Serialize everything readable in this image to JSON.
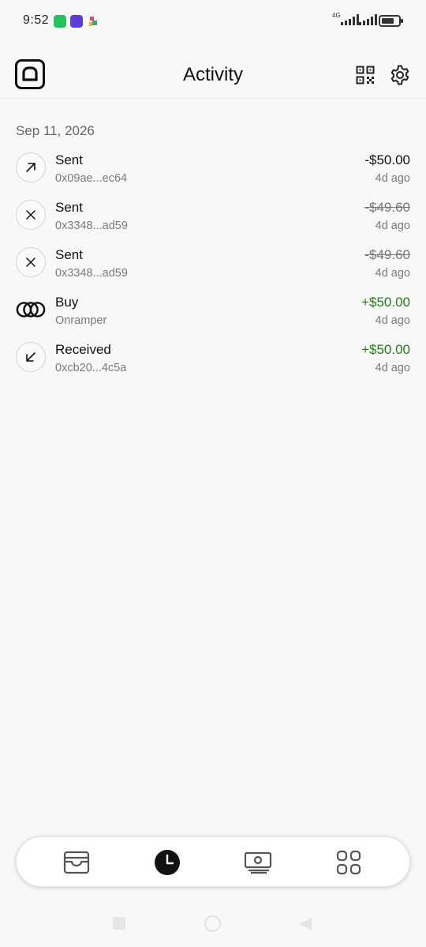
{
  "status_bar": {
    "time": "9:52",
    "network": "4G"
  },
  "header": {
    "title": "Activity",
    "logo_icon": "app-logo-a-icon",
    "qr_icon": "qr-code-icon",
    "settings_icon": "gear-icon"
  },
  "activity": {
    "date": "Sep 11, 2026",
    "items": [
      {
        "title": "Sent",
        "subtitle": "0x09ae...ec64",
        "amount": "-$50.00",
        "time": "4d ago",
        "icon": "arrow-up-right-icon",
        "status": "completed"
      },
      {
        "title": "Sent",
        "subtitle": "0x3348...ad59",
        "amount": "-$49.60",
        "time": "4d ago",
        "icon": "close-icon",
        "status": "failed"
      },
      {
        "title": "Sent",
        "subtitle": "0x3348...ad59",
        "amount": "-$49.60",
        "time": "4d ago",
        "icon": "close-icon",
        "status": "failed"
      },
      {
        "title": "Buy",
        "subtitle": "Onramper",
        "amount": "+$50.00",
        "time": "4d ago",
        "icon": "onramper-logo-icon",
        "status": "positive"
      },
      {
        "title": "Received",
        "subtitle": "0xcb20...4c5a",
        "amount": "+$50.00",
        "time": "4d ago",
        "icon": "arrow-down-left-icon",
        "status": "positive"
      }
    ]
  },
  "bottom_nav": {
    "items": [
      {
        "icon": "wallet-icon",
        "active": false
      },
      {
        "icon": "clock-icon",
        "active": true
      },
      {
        "icon": "cash-icon",
        "active": false
      },
      {
        "icon": "apps-grid-icon",
        "active": false
      }
    ]
  },
  "colors": {
    "background": "#f8f8f8",
    "text_primary": "#111111",
    "text_secondary": "#7a7a7a",
    "positive": "#2a7a1c"
  }
}
